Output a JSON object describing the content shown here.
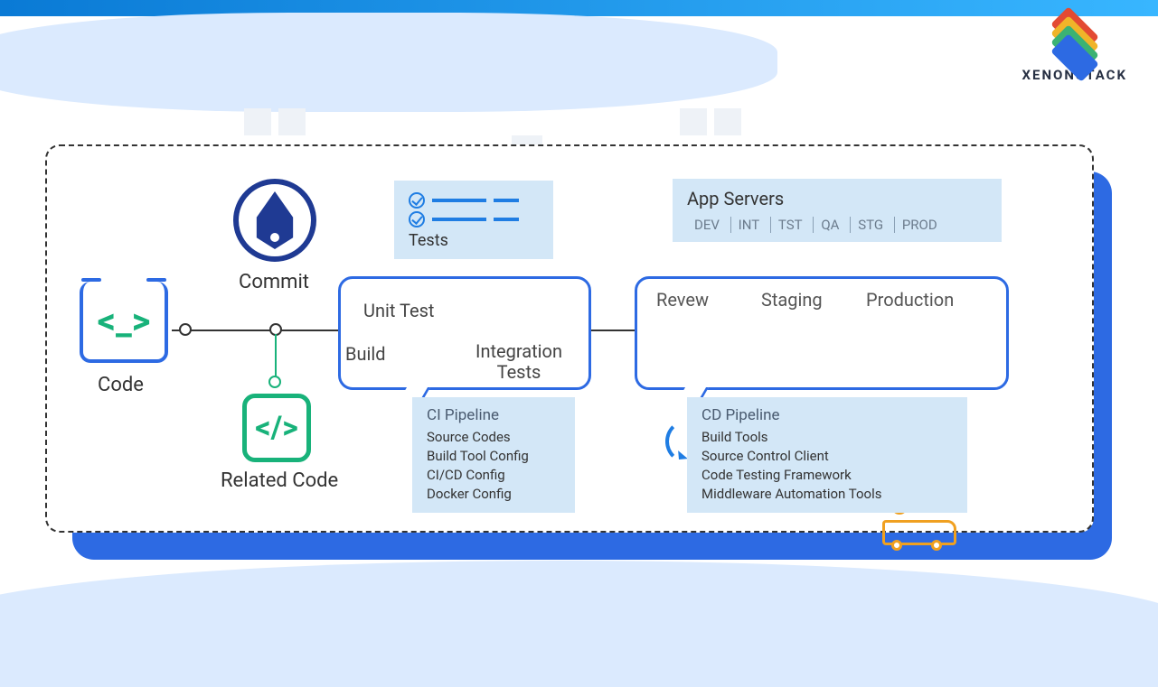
{
  "brand": {
    "name": "XENONSTACK"
  },
  "code": {
    "label": "Code",
    "glyph": "<_>"
  },
  "commit": {
    "label": "Commit"
  },
  "related_code": {
    "label": "Related Code",
    "glyph": "</>"
  },
  "ci_box": {
    "build": "Build",
    "unit_test": "Unit Test",
    "integration": "Integration\nTests"
  },
  "tests_card": {
    "label": "Tests"
  },
  "ci_pipeline": {
    "title": "CI Pipeline",
    "items": [
      "Source Codes",
      "Build Tool Config",
      "CI/CD Config",
      "Docker Config"
    ]
  },
  "servers": {
    "title": "App Servers",
    "envs": [
      "DEV",
      "INT",
      "TST",
      "QA",
      "STG",
      "PROD"
    ]
  },
  "cd_box": {
    "review": "Revew",
    "staging": "Staging",
    "production": "Production"
  },
  "cd_pipeline": {
    "title": "CD Pipeline",
    "items": [
      "Build Tools",
      "Source Control Client",
      "Code Testing Framework",
      "Middleware Automation Tools"
    ]
  }
}
